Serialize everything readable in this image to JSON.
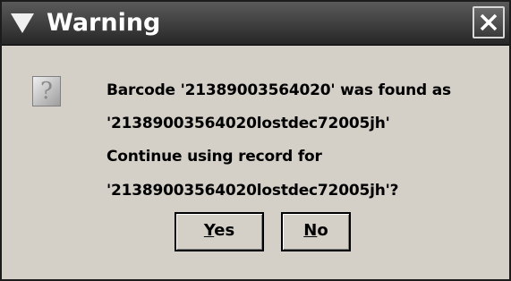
{
  "window": {
    "title": "Warning"
  },
  "message": {
    "line1": "Barcode '21389003564020' was found as",
    "line2": "'21389003564020lostdec72005jh'",
    "line3": "Continue using record for",
    "line4": "'21389003564020lostdec72005jh'?"
  },
  "buttons": {
    "yes_mnemonic": "Y",
    "yes_rest": "es",
    "no_mnemonic": "N",
    "no_rest": "o"
  },
  "icons": {
    "window_menu": "triangle-down-icon",
    "close": "close-icon",
    "message": "question-icon"
  },
  "colors": {
    "titlebar": "#262626",
    "dialog_bg": "#d4d0c8",
    "title_text": "#ffffff"
  }
}
